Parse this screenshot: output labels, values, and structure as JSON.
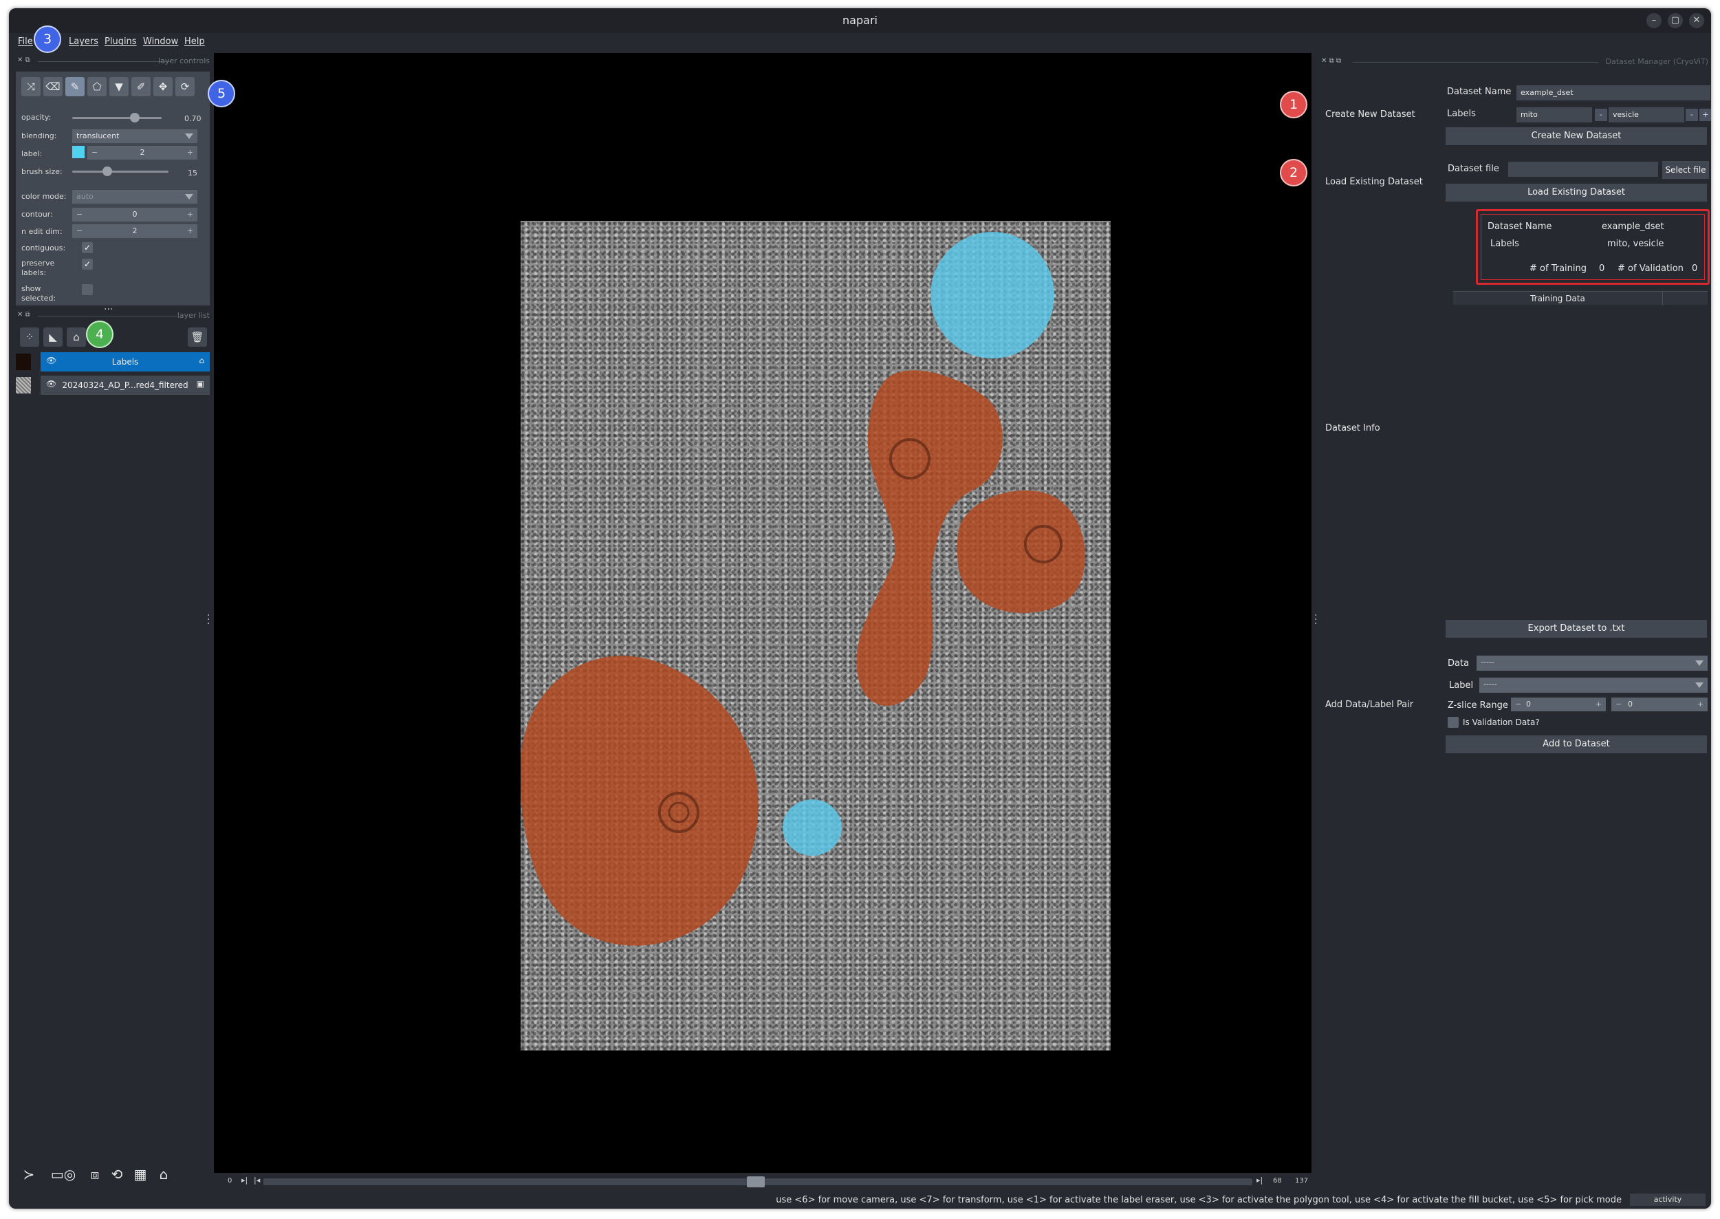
{
  "window": {
    "title": "napari"
  },
  "menu": {
    "file": "File",
    "layers": "Layers",
    "plugins": "Plugins",
    "window": "Window",
    "help": "Help"
  },
  "badges": {
    "b1": "1",
    "b2": "2",
    "b3": "3",
    "b4": "4",
    "b5": "5"
  },
  "layer_controls": {
    "title": "layer controls",
    "opacity_label": "opacity:",
    "opacity_value": "0.70",
    "opacity_fraction": 0.7,
    "blending_label": "blending:",
    "blending_value": "translucent",
    "label_label": "label:",
    "label_value": "2",
    "label_color": "#4fd1f0",
    "brush_size_label": "brush size:",
    "brush_size_value": "15",
    "color_mode_label": "color mode:",
    "color_mode_value": "auto",
    "contour_label": "contour:",
    "contour_value": "0",
    "n_edit_dim_label": "n edit dim:",
    "n_edit_dim_value": "2",
    "contiguous_label": "contiguous:",
    "contiguous_checked": true,
    "preserve_labels_label": "preserve labels:",
    "preserve_labels_checked": true,
    "show_selected_label": "show selected:",
    "show_selected_checked": false
  },
  "layer_list": {
    "title": "layer list",
    "layers": [
      {
        "name": "Labels",
        "selected": true,
        "type_icon": "label-icon"
      },
      {
        "name": "20240324_AD_P...red4_filtered",
        "selected": false,
        "type_icon": "image-icon"
      }
    ]
  },
  "colors": {
    "mito": "#b4491f",
    "vesicle": "#5cc9ea",
    "accent": "#0b6fbf",
    "highlight_box": "#d9292e"
  },
  "dims": {
    "current": "0",
    "right_value": "68",
    "max": "137"
  },
  "status": {
    "message": "use <6> for move camera, use <7> for transform, use <1> for activate the label eraser, use <3> for activate the polygon tool, use <4> for activate the fill bucket, use <5> for pick mode",
    "activity": "activity"
  },
  "dock": {
    "title": "Dataset Manager (CryoViT)",
    "create": {
      "section": "Create New Dataset",
      "dataset_name_label": "Dataset Name",
      "dataset_name_value": "example_dset",
      "labels_label": "Labels",
      "label_1": "mito",
      "label_2": "vesicle",
      "minus": "-",
      "plus": "+",
      "button": "Create New Dataset"
    },
    "load": {
      "section": "Load Existing Dataset",
      "file_label": "Dataset file",
      "file_value": "",
      "select_button": "Select file",
      "button": "Load Existing Dataset"
    },
    "info": {
      "name_label": "Dataset Name",
      "name_value": "example_dset",
      "labels_label": "Labels",
      "labels_value": "mito, vesicle",
      "training_label": "# of Training",
      "training_value": "0",
      "validation_label": "# of Validation",
      "validation_value": "0",
      "tab": "Training Data"
    },
    "dataset_info_section": "Dataset Info",
    "export_button": "Export Dataset to .txt",
    "add": {
      "section": "Add Data/Label Pair",
      "data_label": "Data",
      "data_value": "-----",
      "label_label": "Label",
      "label_value": "-----",
      "zrange_label": "Z-slice Range",
      "z_start": "0",
      "z_end": "0",
      "validation_label": "Is Validation Data?",
      "button": "Add to Dataset"
    }
  }
}
